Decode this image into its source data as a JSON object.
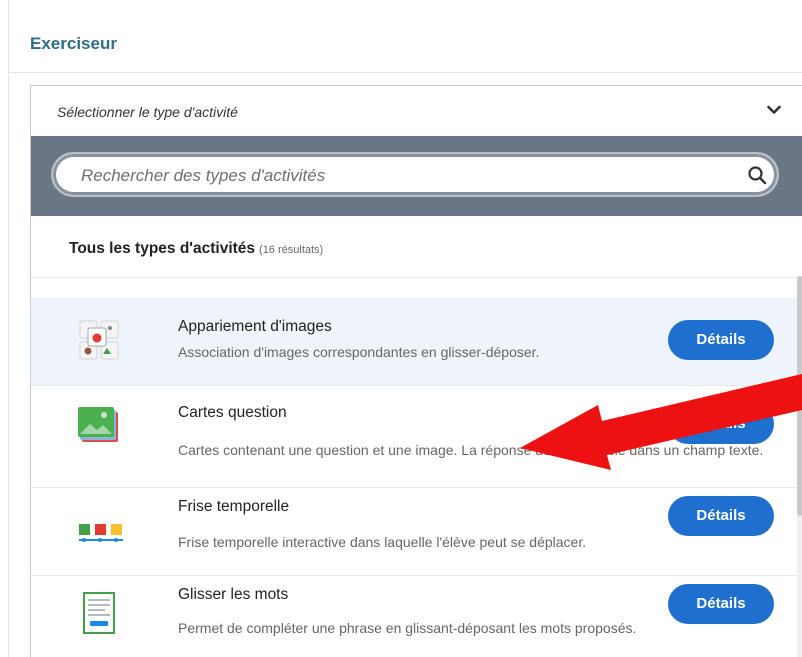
{
  "section": {
    "title": "Exerciseur"
  },
  "selector": {
    "label": "Sélectionner le type d'activité"
  },
  "search": {
    "placeholder": "Rechercher des types d'activités"
  },
  "results": {
    "title": "Tous les types d'activités",
    "count": "(16 résultats)"
  },
  "items": [
    {
      "title": "Appariement d'images",
      "description": "Association d'images correspondantes en glisser-déposer.",
      "button": "Détails",
      "icon": "image-pairing-icon"
    },
    {
      "title": "Cartes question",
      "description": "Cartes contenant une question et une image. La réponse doit être saisie dans un champ texte.",
      "button": "Détails",
      "icon": "question-cards-icon"
    },
    {
      "title": "Frise temporelle",
      "description": "Frise temporelle interactive dans laquelle l'élève peut se déplacer.",
      "button": "Détails",
      "icon": "timeline-icon"
    },
    {
      "title": "Glisser les mots",
      "description": "Permet de compléter une phrase en glissant-déposant les mots proposés.",
      "button": "Détails",
      "icon": "drag-words-icon"
    }
  ],
  "colors": {
    "accent": "#1f6fcf",
    "title": "#2e6e86",
    "search_band": "#6b7685",
    "highlight_row": "#eef4f9",
    "arrow": "#ee1111"
  }
}
